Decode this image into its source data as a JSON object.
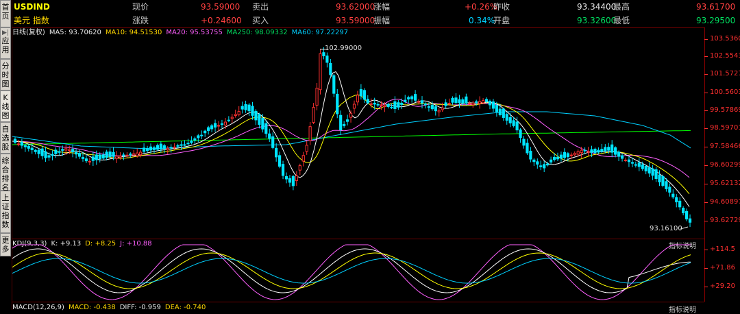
{
  "sidebar": {
    "tabs": [
      {
        "label": "首页",
        "mark": ""
      },
      {
        "label": "应用",
        "mark": "▶|"
      },
      {
        "label": "分时图",
        "mark": ""
      },
      {
        "label": "K线图",
        "mark": ""
      },
      {
        "label": "自选股",
        "mark": ""
      },
      {
        "label": "综合排名",
        "mark": ""
      },
      {
        "label": "上证指数",
        "mark": ""
      },
      {
        "label": "更多",
        "mark": ""
      }
    ]
  },
  "quote": {
    "symbol": "USDIND",
    "name": "美元 指数",
    "row1": [
      {
        "label": "现价",
        "value": "93.59000"
      },
      {
        "label": "卖出",
        "value": "93.62000"
      },
      {
        "label": "涨幅",
        "value": "+0.26%"
      },
      {
        "label": "昨收",
        "value": "93.34400"
      },
      {
        "label": "最高",
        "value": "93.61700"
      }
    ],
    "row2": [
      {
        "label": "涨跌",
        "value": "+0.24600"
      },
      {
        "label": "买入",
        "value": "93.59000"
      },
      {
        "label": "振幅",
        "value": "0.34%"
      },
      {
        "label": "开盘",
        "value": "93.32600"
      },
      {
        "label": "最低",
        "value": "93.29500"
      }
    ]
  },
  "main_legend": {
    "period": "日线(复权)",
    "ma5": "MA5: 93.70620",
    "ma10": "MA10: 94.51530",
    "ma20": "MA20: 95.53755",
    "ma250": "MA250: 98.09332",
    "ma60": "MA60: 97.22297"
  },
  "annotations": {
    "high_label": "102.99000",
    "low_label": "93.16100"
  },
  "price_axis": [
    "103.5360",
    "102.5543",
    "101.5727",
    "100.5603",
    "99.57869",
    "98.59701",
    "97.58466",
    "96.60299",
    "95.62132",
    "94.60897",
    "93.62729"
  ],
  "kdj_legend": {
    "name": "KDJ(9,3,3)",
    "k": "K: +9.13",
    "d": "D: +8.25",
    "j": "J: +10.88",
    "explain": "指标说明"
  },
  "kdj_axis": [
    "+114.5",
    "+71.86",
    "+29.20"
  ],
  "macd_legend": {
    "name": "MACD(12,26,9)",
    "macd": "MACD: -0.438",
    "dif": "DIFF: -0.959",
    "dea": "DEA: -0.740",
    "explain": "指标说明"
  },
  "colors": {
    "up": "#ff3030",
    "down": "#00e5ff",
    "ma5": "#ffffff",
    "ma10": "#ffff00",
    "ma20": "#ff60ff",
    "ma250": "#00ff00",
    "ma60": "#00d0ff"
  }
}
